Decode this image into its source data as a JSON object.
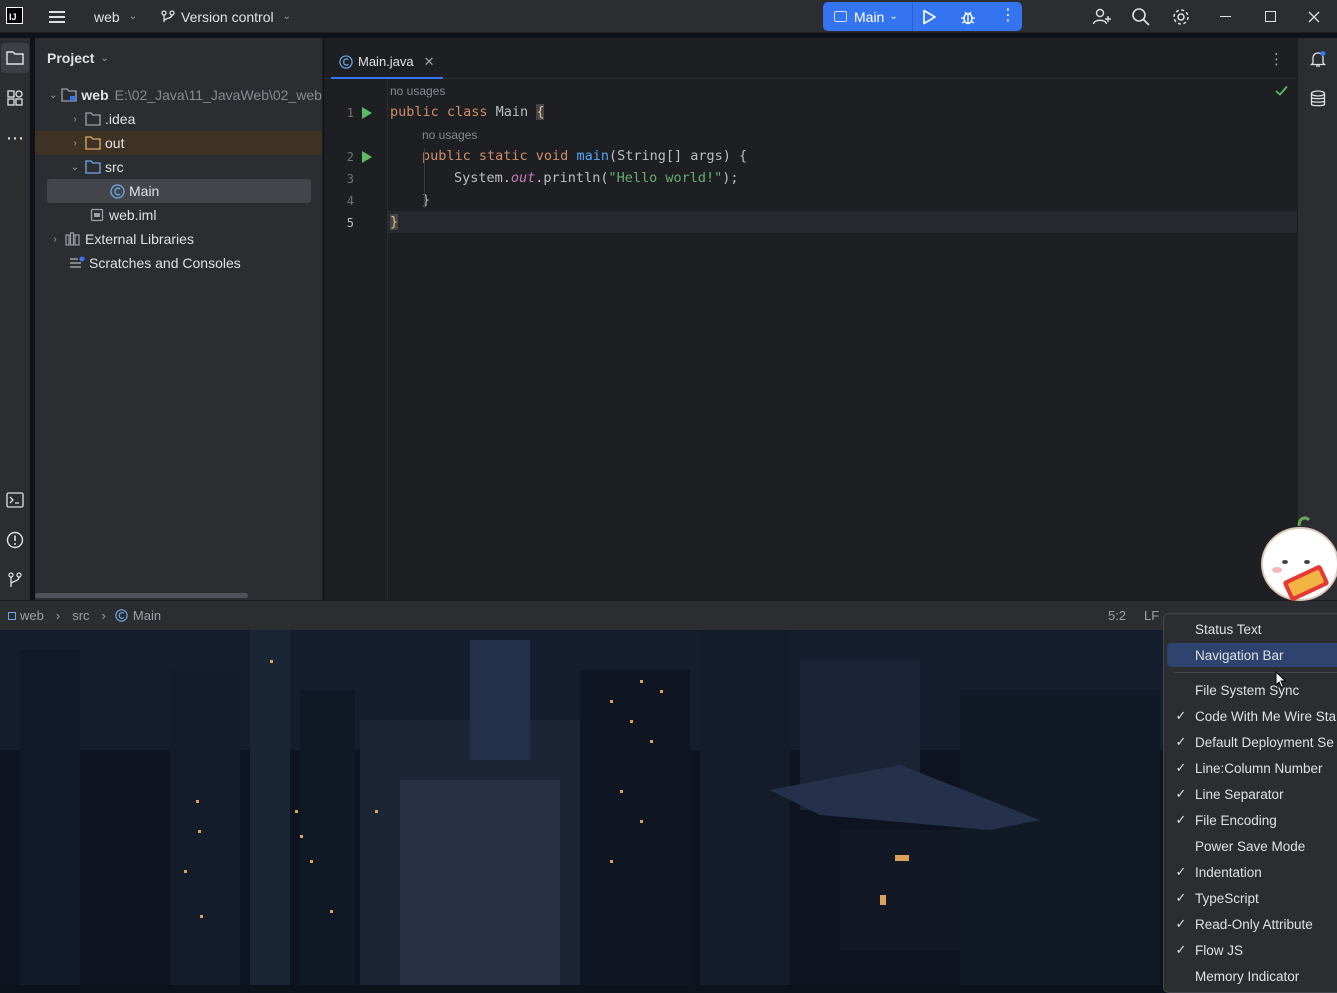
{
  "titlebar": {
    "project_name": "web",
    "vcs_label": "Version control",
    "run_config": "Main"
  },
  "project_panel": {
    "title": "Project",
    "tree": [
      {
        "label": "web",
        "path": "E:\\02_Java\\11_JavaWeb\\02_web\\"
      },
      {
        "label": ".idea"
      },
      {
        "label": "out"
      },
      {
        "label": "src"
      },
      {
        "label": "Main"
      },
      {
        "label": "web.iml"
      },
      {
        "label": "External Libraries"
      },
      {
        "label": "Scratches and Consoles"
      }
    ]
  },
  "editor": {
    "tab_label": "Main.java",
    "hint_usages": "no usages",
    "line_numbers": [
      "1",
      "2",
      "3",
      "4",
      "5"
    ],
    "code": {
      "l1_kw": "public class ",
      "l1_name": "Main ",
      "l1_brace": "{",
      "l2_kw": "public static void ",
      "l2_fn": "main",
      "l2_rest": "(String[] args) {",
      "l3_pre": "System.",
      "l3_static": "out",
      "l3_mid": ".println(",
      "l3_str": "\"Hello world!\"",
      "l3_end": ");",
      "l4": "}",
      "l5": "}"
    }
  },
  "statusbar": {
    "breadcrumbs": [
      "web",
      "src",
      "Main"
    ],
    "position": "5:2",
    "line_sep": "LF"
  },
  "context_menu": {
    "items": [
      {
        "label": "Status Text",
        "checked": false
      },
      {
        "label": "Navigation Bar",
        "checked": false,
        "selected": true
      },
      {
        "label": "File System Sync",
        "checked": false
      },
      {
        "label": "Code With Me Wire Sta",
        "checked": true
      },
      {
        "label": "Default Deployment Se",
        "checked": true
      },
      {
        "label": "Line:Column Number",
        "checked": true
      },
      {
        "label": "Line Separator",
        "checked": true
      },
      {
        "label": "File Encoding",
        "checked": true
      },
      {
        "label": "Power Save Mode",
        "checked": false
      },
      {
        "label": "Indentation",
        "checked": true
      },
      {
        "label": "TypeScript",
        "checked": true
      },
      {
        "label": "Read-Only Attribute",
        "checked": true
      },
      {
        "label": "Flow JS",
        "checked": true
      },
      {
        "label": "Memory Indicator",
        "checked": false
      }
    ],
    "check_glyph": "✓"
  },
  "colors": {
    "accent": "#3574f0",
    "run_green": "#5fb865",
    "folder_out": "#3d3223"
  }
}
